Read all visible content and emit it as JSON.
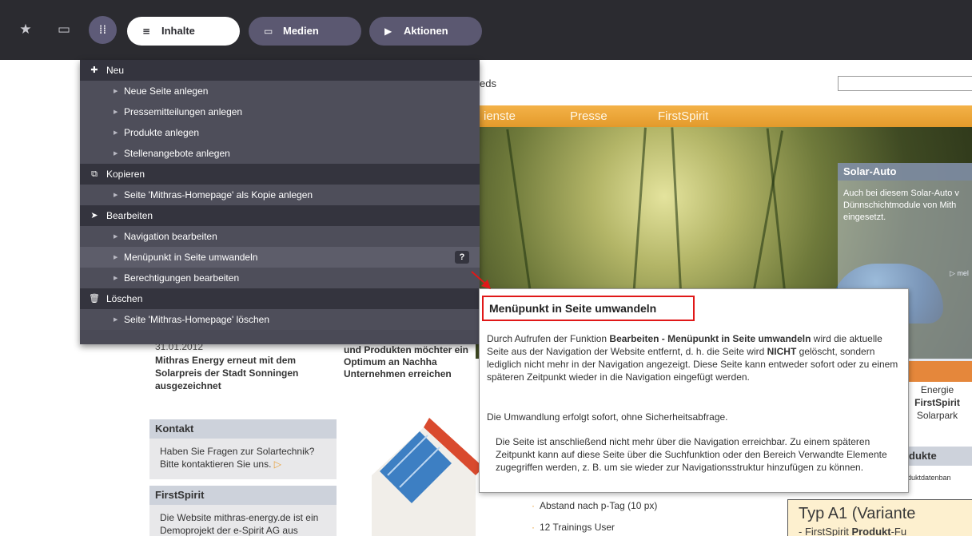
{
  "toolbar": {
    "favorites_icon": "star-sparkle-icon",
    "devices_icon": "devices-icon",
    "apps_icon": "grid-icon",
    "tabs": [
      {
        "label": "Inhalte",
        "icon": "list-icon"
      },
      {
        "label": "Medien",
        "icon": "monitor-icon"
      },
      {
        "label": "Aktionen",
        "icon": "play-icon"
      }
    ]
  },
  "menu": {
    "sections": [
      {
        "label": "Neu",
        "icon": "plus-icon"
      },
      {
        "label": "Kopieren",
        "icon": "copy-icon"
      },
      {
        "label": "Bearbeiten",
        "icon": "cursor-icon"
      },
      {
        "label": "Löschen",
        "icon": "trash-icon"
      }
    ],
    "items": [
      "Neue Seite anlegen",
      "Pressemitteilungen anlegen",
      "Produkte anlegen",
      "Stellenangebote anlegen",
      "Seite 'Mithras-Homepage' als Kopie anlegen",
      "Navigation bearbeiten",
      "Menüpunkt in Seite umwandeln",
      "Berechtigungen bearbeiten",
      "Seite 'Mithras-Homepage' löschen"
    ],
    "help_label": "?"
  },
  "tooltip": {
    "title": "Menüpunkt in Seite umwandeln",
    "p1_a": "Durch Aufrufen der Funktion ",
    "p1_b": "Bearbeiten - Menüpunkt in Seite umwandeln",
    "p1_c": " wird die aktuelle Seite aus der Navigation der Website entfernt, d. h. die Seite wird ",
    "p1_d": "NICHT",
    "p1_e": " gelöscht, sondern lediglich nicht mehr in der Navigation angezeigt. Diese Seite kann entweder sofort oder zu einem späteren Zeitpunkt wieder in die Navigation eingefügt werden.",
    "p2": "Die Umwandlung erfolgt sofort, ohne Sicherheitsabfrage.",
    "p3": "Die Seite ist anschließend nicht mehr über die Navigation erreichbar. Zu einem späteren Zeitpunkt kann auf diese Seite über die Suchfunktion oder den Bereich Verwandte Elemente zugegriffen werden, z. B. um sie wieder zur Navigationsstruktur hinzufügen zu können."
  },
  "site": {
    "feeds": "eds",
    "nav": [
      "ienste",
      "Presse",
      "FirstSpirit"
    ],
    "solar_title": "Solar-Auto",
    "solar_text": "Auch bei diesem Solar-Auto v Dünnschichtmodule von Mith eingesetzt.",
    "solar_more": "▷ mel",
    "news_date": "31.01.2012",
    "news_title": "Mithras Energy erneut mit dem Solarpreis der Stadt Sonningen ausgezeichnet",
    "intro": "und Produkten möchter ein Optimum an Nachha Unternehmen erreichen",
    "kontakt_title": "Kontakt",
    "kontakt_text": "Haben Sie Fragen zur Solartechnik? Bitte kontaktieren Sie uns.",
    "firstspirit_title": "FirstSpirit",
    "firstspirit_text": "Die Website mithras-energy.de ist ein Demoprojekt der e-Spirit AG aus",
    "bullets": [
      "Abstand nach p-Tag (10 px)",
      "12 Trainings User"
    ],
    "right_list": [
      "Energie",
      "FirstSpirit",
      "Solarpark"
    ],
    "right_dukte": "dukte",
    "right_small": "duktdatenban",
    "typ_title": "Typ A1 (Variante",
    "typ_sub_a": "- FirstSpirit ",
    "typ_sub_b": "Produkt",
    "typ_sub_c": "-Fu"
  }
}
